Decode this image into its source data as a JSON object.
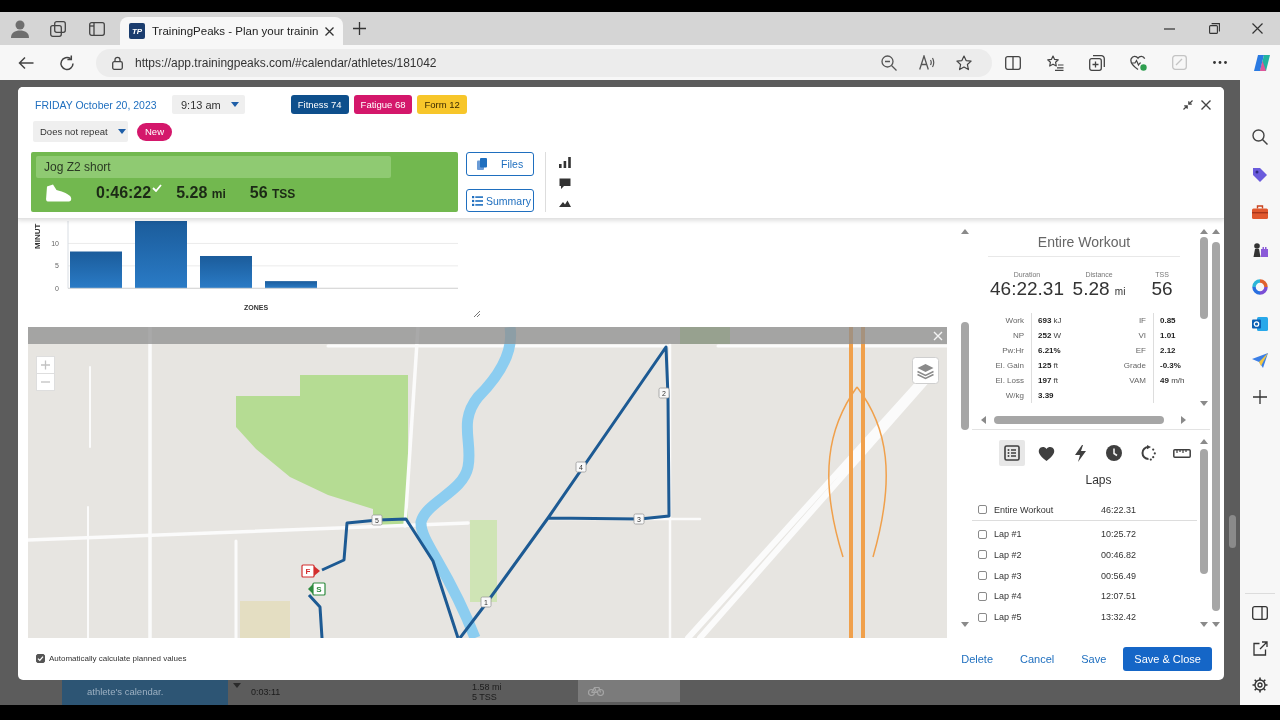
{
  "browser": {
    "tab": {
      "logo": "TP",
      "title": "TrainingPeaks - Plan your trainin",
      "selected": true
    },
    "address": "https://app.trainingpeaks.com/#calendar/athletes/181042"
  },
  "dialog": {
    "date": "FRIDAY October 20, 2023",
    "time": "9:13 am",
    "badges": [
      {
        "label": "Fitness 74",
        "color": "#0e4f8c"
      },
      {
        "label": "Fatigue 68",
        "color": "#d4176b"
      },
      {
        "label": "Form 12",
        "color": "#f7c62a"
      }
    ],
    "repeat": "Does not repeat",
    "status_badge": "New",
    "workout": {
      "title": "Jog Z2 short",
      "duration": "0:46:22",
      "completed": true,
      "distance": "5.28",
      "distance_unit": "mi",
      "tss": "56",
      "tss_unit": "TSS"
    },
    "buttons": [
      "Files",
      "Summary"
    ],
    "zones_chart": {
      "chart_data": {
        "type": "bar",
        "xlabel": "ZONES",
        "ylabel": "MINUT",
        "values": [
          8.2,
          15,
          7.2,
          1.6,
          0,
          0
        ],
        "yticks": [
          0,
          5,
          10
        ],
        "ylim": [
          0,
          15
        ]
      }
    },
    "map": {
      "lap_markers": [
        "1",
        "2",
        "3",
        "4",
        "5"
      ],
      "start_marker": "S",
      "finish_marker": "F"
    },
    "summary": {
      "title": "Entire Workout",
      "headline": [
        {
          "label": "Duration",
          "value": "46:22.31"
        },
        {
          "label": "Distance",
          "value": "5.28",
          "unit": "mi"
        },
        {
          "label": "TSS",
          "value": "56"
        }
      ],
      "left": [
        {
          "label": "Work",
          "value": "693",
          "unit": "kJ"
        },
        {
          "label": "NP",
          "value": "252",
          "unit": "W"
        },
        {
          "label": "Pw:Hr",
          "value": "6.21%"
        },
        {
          "label": "El. Gain",
          "value": "125",
          "unit": "ft"
        },
        {
          "label": "El. Loss",
          "value": "197",
          "unit": "ft"
        },
        {
          "label": "W/kg",
          "value": "3.39"
        }
      ],
      "right": [
        {
          "label": "IF",
          "value": "0.85"
        },
        {
          "label": "VI",
          "value": "1.01"
        },
        {
          "label": "EF",
          "value": "2.12"
        },
        {
          "label": "Grade",
          "value": "-0.3%"
        },
        {
          "label": "VAM",
          "value": "49",
          "unit": "m/h"
        }
      ]
    },
    "analysis_tabs": [
      {
        "selected": true
      },
      {
        "selected": false
      },
      {
        "selected": false
      },
      {
        "selected": false
      },
      {
        "selected": false
      },
      {
        "selected": false
      }
    ],
    "laps": {
      "title": "Laps",
      "rows": [
        {
          "kind": "total",
          "name": "Entire Workout",
          "time": "46:22.31",
          "checked": false
        },
        {
          "kind": "lap",
          "name": "Lap #1",
          "time": "10:25.72",
          "checked": false
        },
        {
          "kind": "lap",
          "name": "Lap #2",
          "time": "00:46.82",
          "checked": false
        },
        {
          "kind": "lap",
          "name": "Lap #3",
          "time": "00:56.49",
          "checked": false
        },
        {
          "kind": "lap",
          "name": "Lap #4",
          "time": "12:07.51",
          "checked": false
        },
        {
          "kind": "lap",
          "name": "Lap #5",
          "time": "13:32.42",
          "checked": false
        }
      ]
    },
    "auto_calculate": {
      "label": "Automatically calculate planned values",
      "checked": true
    },
    "actions": [
      "Delete",
      "Cancel",
      "Save"
    ],
    "save_close": "Save & Close"
  },
  "calendar_behind": {
    "note": "athlete's calendar.",
    "duration": "0:03:11",
    "distance": "1.58 mi",
    "tss": "5 TSS"
  }
}
